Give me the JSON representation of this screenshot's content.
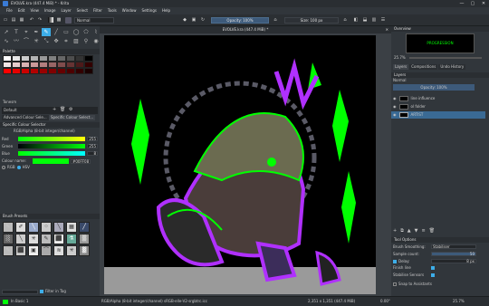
{
  "window": {
    "title": "EVOLVE.kra (447.4 MiB) * - Krita",
    "min": "—",
    "max": "▢",
    "close": "✕"
  },
  "menu": [
    "File",
    "Edit",
    "View",
    "Image",
    "Layer",
    "Select",
    "Filter",
    "Tools",
    "Window",
    "Settings",
    "Help"
  ],
  "toolbar": {
    "blend_mode": "Normal",
    "opacity": "Opacity: 100%",
    "size": "Size: 100 px"
  },
  "canvas": {
    "tab_title": "EVOLVE.kra (447.4 MiB) *"
  },
  "palette": {
    "title": "Palette",
    "name": "Tonesm"
  },
  "default_preset": "Default",
  "color_panels": {
    "tab1": "Advanced Colour Sele...",
    "tab2": "Specific Colour Select..."
  },
  "specific_color": {
    "title": "Specific Colour Selector",
    "model": "RGB/Alpha (8-bit integer/channel)",
    "red_label": "Red",
    "red": "255",
    "green_label": "Green",
    "green": "255",
    "blue_label": "Blue",
    "blue": "8",
    "colour_name_label": "Colour name:",
    "colour_name": "#00FF08",
    "model_hsv": "HSV",
    "model_rgb": "RGB"
  },
  "brush_presets": {
    "title": "Brush Presets",
    "filter_tag": "Filter in Tag",
    "search_placeholder": "Search"
  },
  "overview": {
    "title": "Overview",
    "zoom": "25.7%",
    "thumb_text": "PROGRESSION"
  },
  "layers": {
    "title": "Layers",
    "tabs": [
      "Layers",
      "Compositions",
      "Undo History"
    ],
    "blend": "Normal",
    "opacity": "Opacity: 100%",
    "items": [
      {
        "name": "line influence"
      },
      {
        "name": "ol folder"
      },
      {
        "name": "ARTIST"
      }
    ]
  },
  "tool_options": {
    "title": "Tool Options",
    "smoothing_label": "Brush Smoothing:",
    "smoothing": "Stabiliser",
    "sample_label": "Sample count:",
    "sample": "50",
    "delay_label": "Delay:",
    "delay": "8 px",
    "finish_label": "Finish line",
    "stab_label": "Stabilise Sensors",
    "snap_label": "Snap to Assistants"
  },
  "status": {
    "left": "In Basic 1",
    "info": "RGB/Alpha (8-bit integer/channel) sRGB-elle-V2-srgbtrc.icc",
    "size": "2,351 x 1,351 (447.4 MiB)",
    "angle": "0.00°",
    "zoom": "25.7%"
  },
  "colors": {
    "accent": "#3daee9",
    "fg": "#00ff08",
    "bg": "#000000",
    "neon_purple": "#b030ff",
    "neon_green": "#00ff00"
  }
}
